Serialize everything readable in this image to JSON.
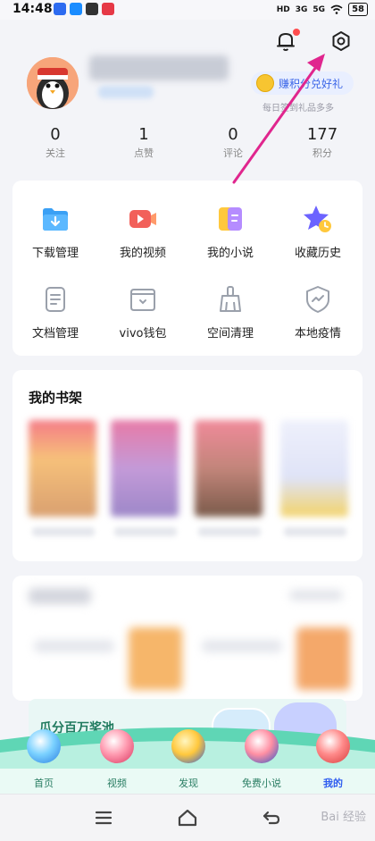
{
  "status_bar": {
    "time": "14:48",
    "signal_1": "3G",
    "signal_2": "5G",
    "hd_label": "HD",
    "battery": "58"
  },
  "profile": {
    "points_badge": "赚积分兑好礼",
    "points_sub": "每日签到礼品多多"
  },
  "stats": [
    {
      "value": "0",
      "label": "关注"
    },
    {
      "value": "1",
      "label": "点赞"
    },
    {
      "value": "0",
      "label": "评论"
    },
    {
      "value": "177",
      "label": "积分"
    }
  ],
  "tools": [
    {
      "label": "下载管理",
      "icon": "download-folder-icon"
    },
    {
      "label": "我的视频",
      "icon": "video-icon"
    },
    {
      "label": "我的小说",
      "icon": "novel-icon"
    },
    {
      "label": "收藏历史",
      "icon": "star-history-icon"
    },
    {
      "label": "文档管理",
      "icon": "document-icon"
    },
    {
      "label": "vivo钱包",
      "icon": "wallet-icon"
    },
    {
      "label": "空间清理",
      "icon": "broom-icon"
    },
    {
      "label": "本地疫情",
      "icon": "shield-icon"
    }
  ],
  "bookshelf": {
    "title": "我的书架"
  },
  "banner": {
    "text": "瓜分百万奖池"
  },
  "tabs": [
    {
      "label": "首页",
      "active": false
    },
    {
      "label": "视频",
      "active": false
    },
    {
      "label": "发现",
      "active": false
    },
    {
      "label": "免费小说",
      "active": false
    },
    {
      "label": "我的",
      "active": true
    }
  ],
  "watermark": "Bai 经验",
  "colors": {
    "accent": "#2d5cf0",
    "notification_dot": "#ff4d4f",
    "arrow": "#e0268e",
    "tab_green": "#3cc9a0"
  }
}
